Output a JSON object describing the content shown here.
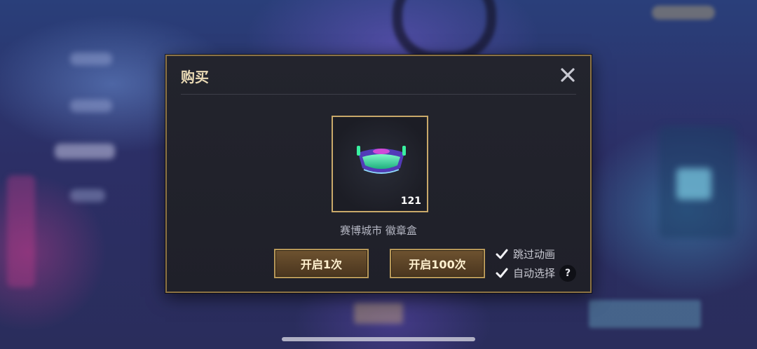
{
  "dialog": {
    "title": "购买",
    "close_icon": "close-icon",
    "item": {
      "name": "赛博城市 徽章盒",
      "count": "121",
      "icon": "cyber-badge-box-icon"
    },
    "buttons": {
      "open_once": "开启1次",
      "open_hundred": "开启100次"
    },
    "options": {
      "skip_animation": {
        "label": "跳过动画",
        "checked": true
      },
      "auto_select": {
        "label": "自动选择",
        "checked": true
      }
    },
    "help_label": "?"
  },
  "colors": {
    "accent_gold": "#c9a96a",
    "button_brown": "#5a4226",
    "dialog_bg": "#23242d"
  }
}
